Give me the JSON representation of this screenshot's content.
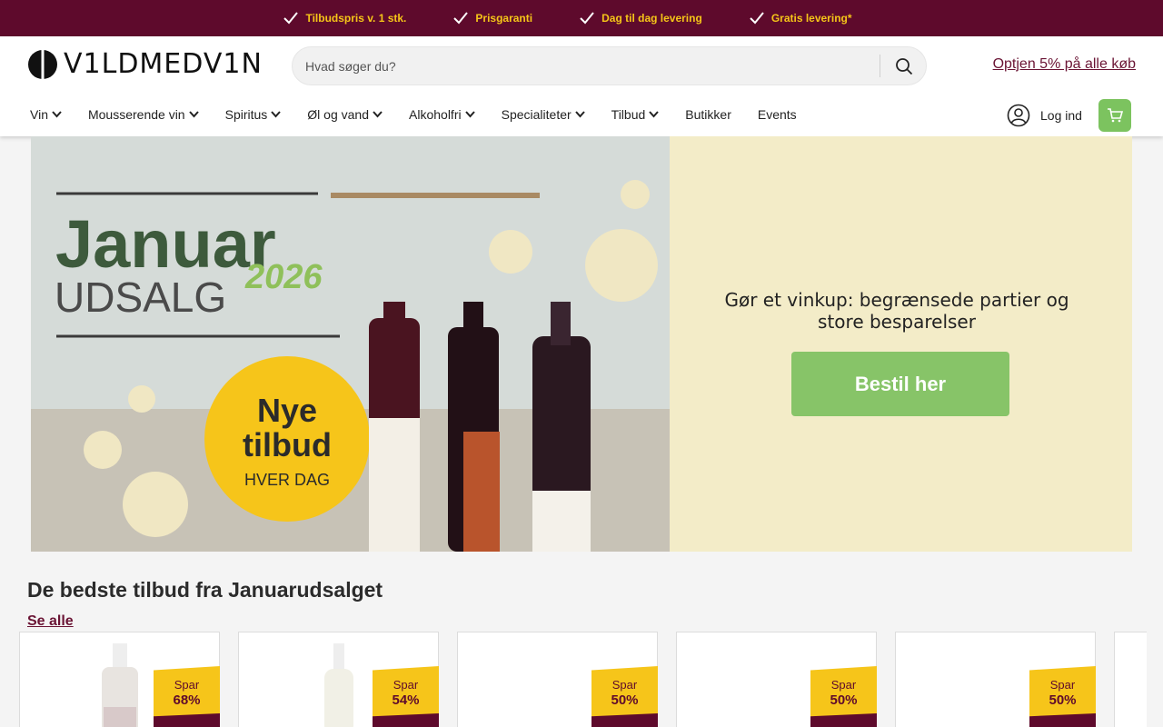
{
  "usp": [
    {
      "text": "Tilbudspris v. 1 stk."
    },
    {
      "text": "Prisgaranti"
    },
    {
      "text": "Dag til dag levering"
    },
    {
      "text": "Gratis levering*"
    }
  ],
  "header": {
    "logo_text": "V1LDMEDV1N",
    "search_placeholder": "Hvad søger du?",
    "promo_link": "Optjen 5% på alle køb",
    "login_label": "Log ind"
  },
  "nav": [
    {
      "label": "Vin",
      "dropdown": true
    },
    {
      "label": "Mousserende vin",
      "dropdown": true
    },
    {
      "label": "Spiritus",
      "dropdown": true
    },
    {
      "label": "Øl og vand",
      "dropdown": true
    },
    {
      "label": "Alkoholfri",
      "dropdown": true
    },
    {
      "label": "Specialiteter",
      "dropdown": true
    },
    {
      "label": "Tilbud",
      "dropdown": true
    },
    {
      "label": "Butikker",
      "dropdown": false
    },
    {
      "label": "Events",
      "dropdown": false
    }
  ],
  "hero": {
    "image_heading": "Januar",
    "image_subheading": "UDSALG",
    "image_year": "2026",
    "image_badge_line1": "Nye",
    "image_badge_line2": "tilbud",
    "image_badge_line3": "HVER DAG",
    "text": "Gør et vinkup: begrænsede partier og store besparelser",
    "button": "Bestil her"
  },
  "section": {
    "title": "De bedste tilbud fra Januarudsalget",
    "see_all": "Se alle"
  },
  "products": [
    {
      "spar": "Spar",
      "discount": "68%"
    },
    {
      "spar": "Spar",
      "discount": "54%"
    },
    {
      "spar": "Spar",
      "discount": "50%"
    },
    {
      "spar": "Spar",
      "discount": "50%"
    },
    {
      "spar": "Spar",
      "discount": "50%"
    }
  ],
  "colors": {
    "brand_dark": "#5e0a2c",
    "usp_text": "#f5c518",
    "accent_green": "#87c468",
    "cart_green": "#7cc35f",
    "hero_panel": "#f3ecc8",
    "ribbon_yellow": "#f6c51a"
  },
  "icons": {
    "usp": "check-icon",
    "search": "search-icon",
    "nav_dropdown": "chevron-down-icon",
    "login": "user-icon",
    "cart": "cart-icon"
  }
}
